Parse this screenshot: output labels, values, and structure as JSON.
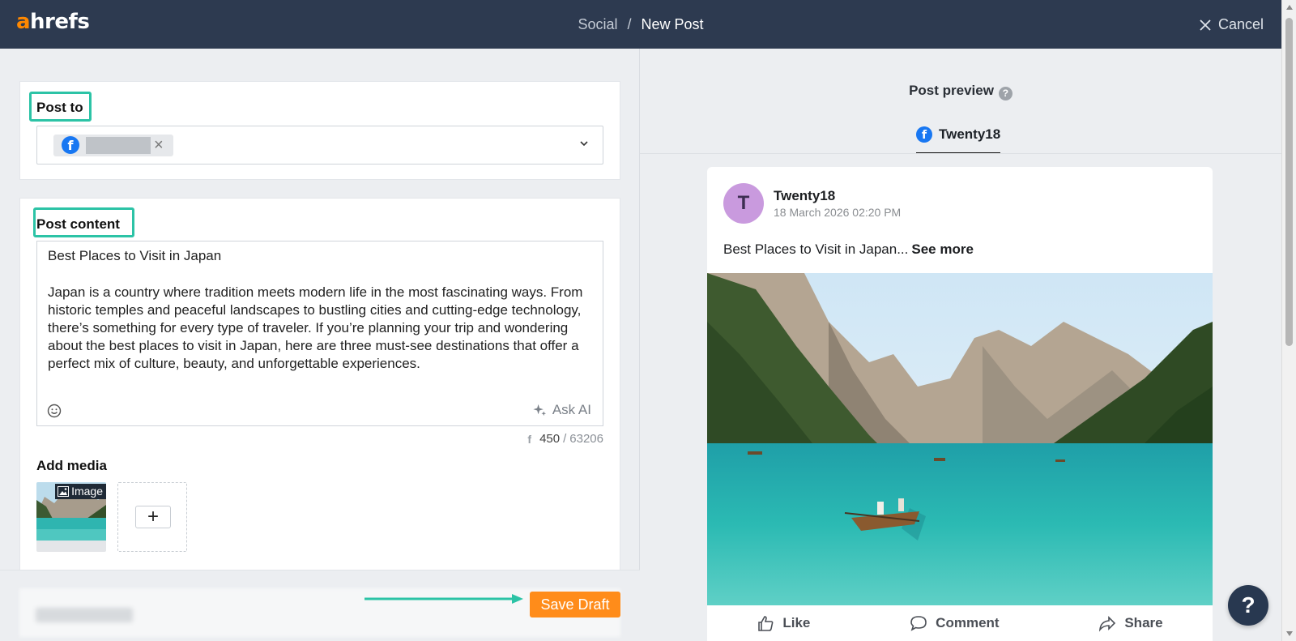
{
  "header": {
    "logo_prefix": "a",
    "logo_rest": "hrefs",
    "breadcrumb_parent": "Social",
    "breadcrumb_sep": "/",
    "breadcrumb_current": "New Post",
    "cancel_label": "Cancel"
  },
  "post_to": {
    "label": "Post to",
    "selected_account_network_icon": "facebook-icon",
    "selected_account_name": ""
  },
  "post_content": {
    "label": "Post content",
    "title_line": "Best Places to Visit in Japan",
    "body": "Japan is a country where tradition meets modern life in the most fascinating ways. From historic temples and peaceful landscapes to bustling cities and cutting-edge technology, there’s something for every type of traveler. If you’re planning your trip and wondering about the best places to visit in Japan, here are three must-see destinations that offer a perfect mix of culture, beauty, and unforgettable experiences.",
    "ask_ai_label": "Ask AI",
    "char_count": "450",
    "char_sep": "/",
    "char_limit": "63206"
  },
  "media": {
    "label": "Add media",
    "items": [
      {
        "type_label": "Image"
      }
    ],
    "add_button_label": "+"
  },
  "footer": {
    "save_draft_label": "Save Draft"
  },
  "preview": {
    "title": "Post preview",
    "help_glyph": "?",
    "tab_label": "Twenty18",
    "avatar_initial": "T",
    "page_name": "Twenty18",
    "timestamp": "18 March 2026 02:20 PM",
    "excerpt": "Best Places to Visit in Japan...",
    "see_more": "See more",
    "actions": {
      "like": "Like",
      "comment": "Comment",
      "share": "Share"
    }
  },
  "help_fab_glyph": "?",
  "colors": {
    "header_bg": "#2d3a50",
    "accent_orange": "#ff8c1a",
    "highlight_teal": "#2cc3a6",
    "facebook_blue": "#1877f2",
    "avatar_purple": "#c99ade"
  }
}
